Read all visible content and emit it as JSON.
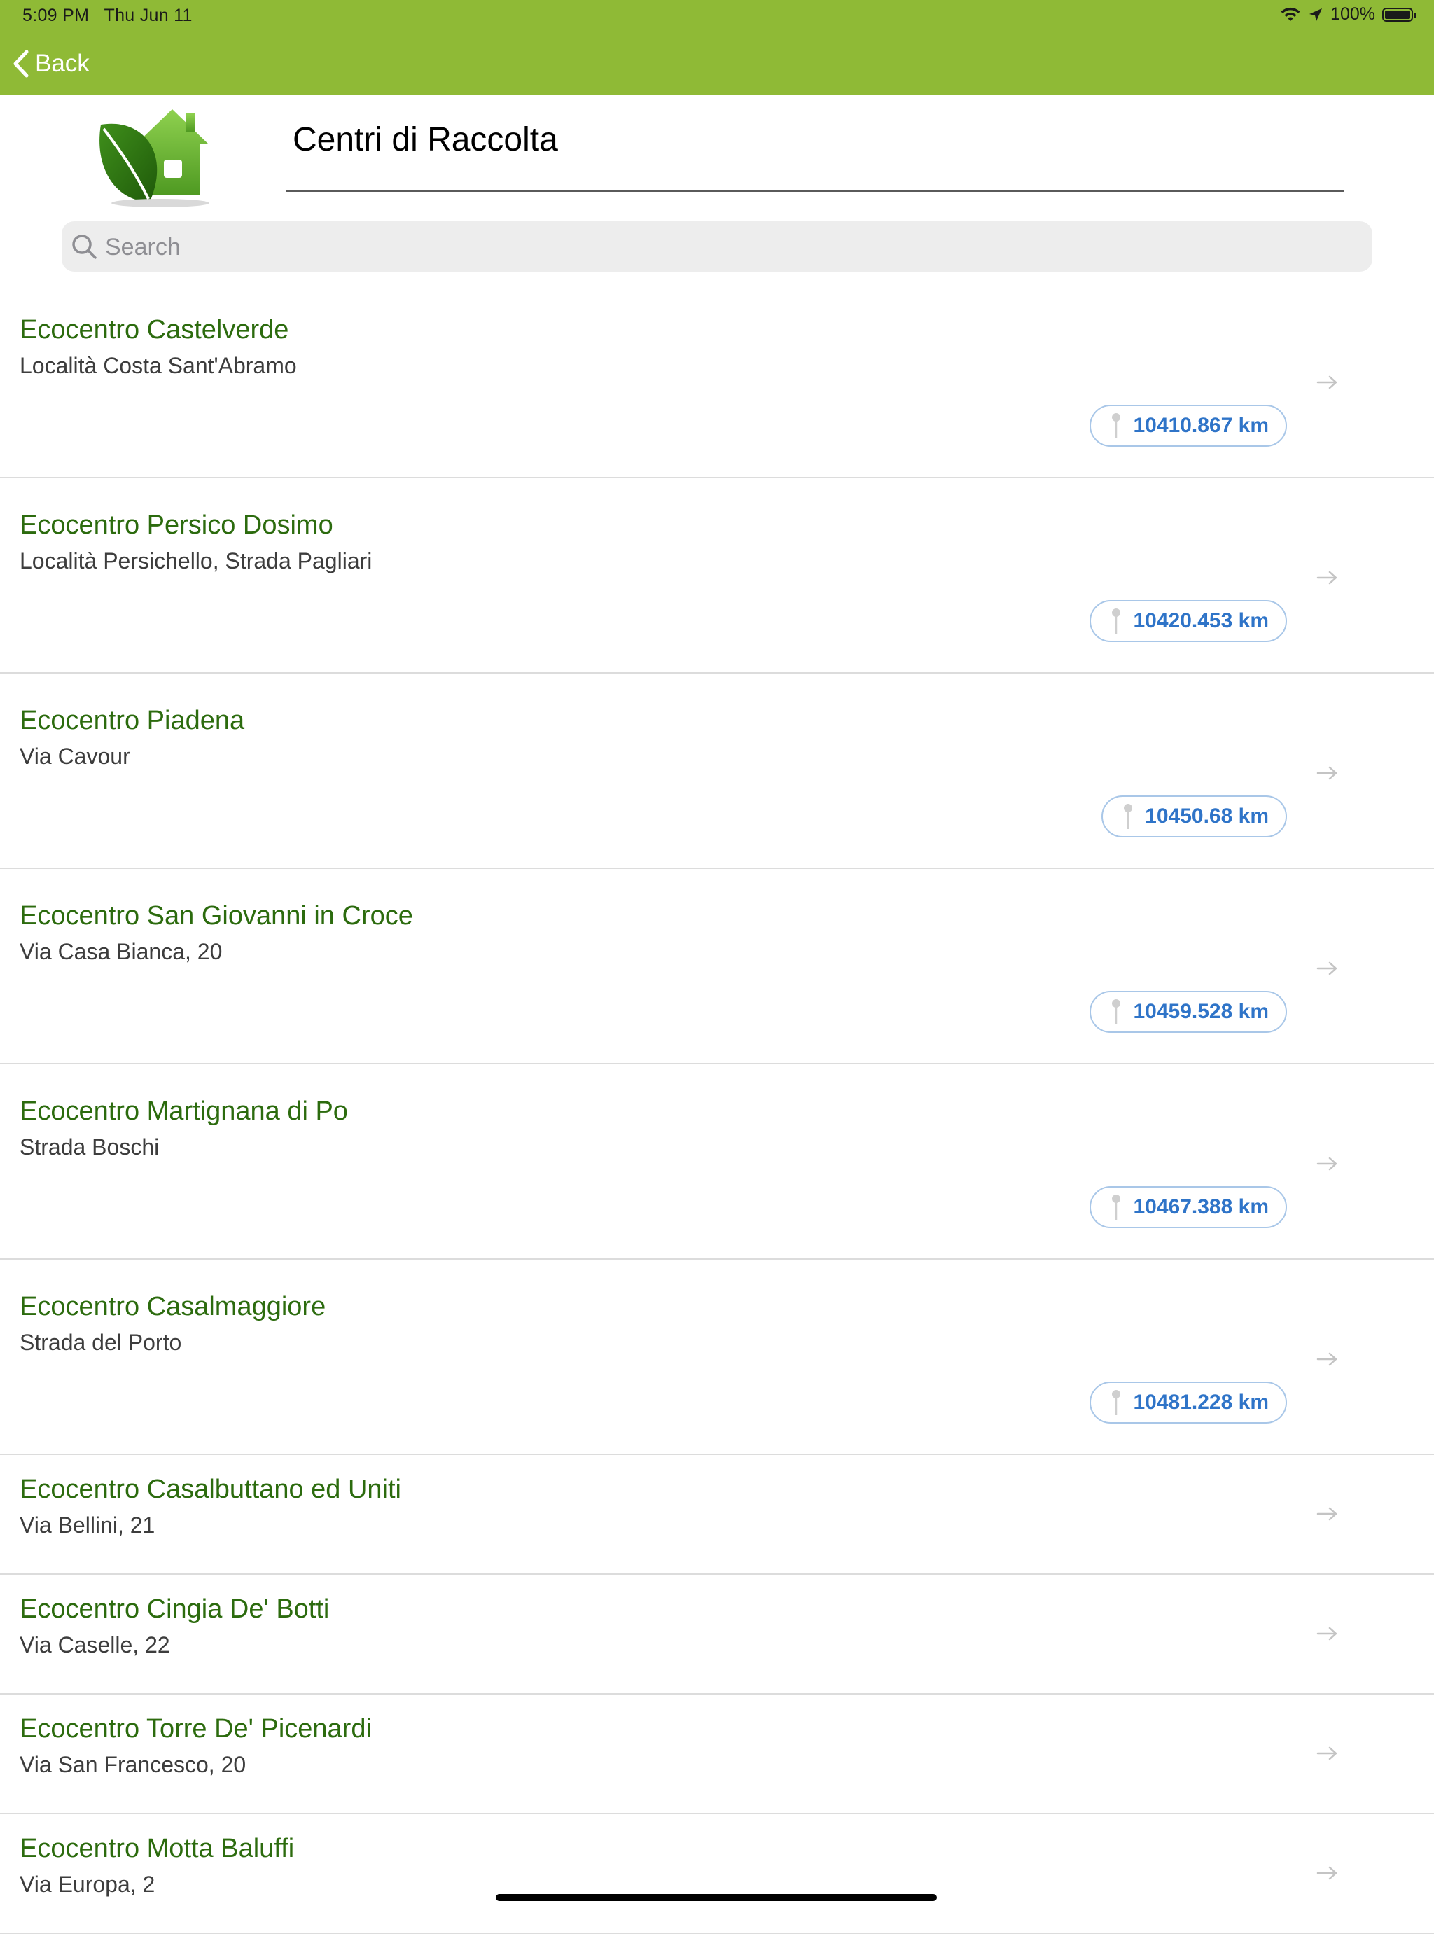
{
  "status_bar": {
    "time": "5:09 PM",
    "date": "Thu Jun 11",
    "battery": "100%"
  },
  "nav": {
    "back_label": "Back"
  },
  "header": {
    "title": "Centri di Raccolta"
  },
  "search": {
    "placeholder": "Search",
    "value": ""
  },
  "colors": {
    "bar_green": "#8fba36",
    "title_green": "#2c6b0e",
    "distance_blue": "#2f74c8"
  },
  "items": [
    {
      "name": "Ecocentro Castelverde",
      "address": "Località Costa Sant'Abramo",
      "distance": "10410.867 km"
    },
    {
      "name": "Ecocentro Persico Dosimo",
      "address": "Località Persichello, Strada Pagliari",
      "distance": "10420.453 km"
    },
    {
      "name": "Ecocentro Piadena",
      "address": "Via Cavour",
      "distance": "10450.68 km"
    },
    {
      "name": "Ecocentro San Giovanni in Croce",
      "address": "Via Casa Bianca, 20",
      "distance": "10459.528 km"
    },
    {
      "name": "Ecocentro Martignana di Po",
      "address": "Strada Boschi",
      "distance": "10467.388 km"
    },
    {
      "name": "Ecocentro Casalmaggiore",
      "address": "Strada del Porto",
      "distance": "10481.228 km"
    },
    {
      "name": "Ecocentro Casalbuttano ed Uniti",
      "address": "Via Bellini, 21"
    },
    {
      "name": "Ecocentro Cingia De' Botti",
      "address": "Via Caselle, 22"
    },
    {
      "name": "Ecocentro Torre De' Picenardi",
      "address": "Via San Francesco, 20"
    },
    {
      "name": "Ecocentro Motta Baluffi",
      "address": "Via Europa, 2"
    }
  ]
}
